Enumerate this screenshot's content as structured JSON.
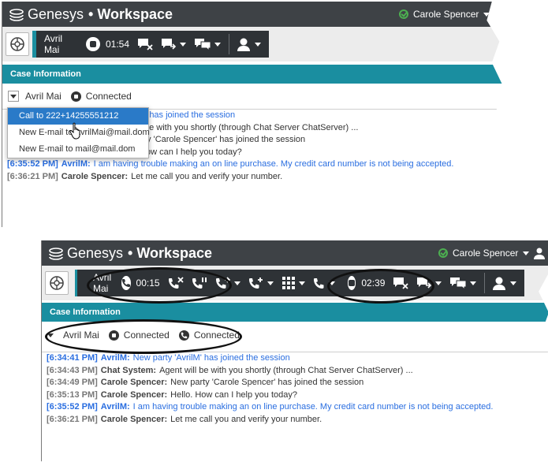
{
  "app": {
    "brand": "Genesys",
    "title": "Workspace"
  },
  "user": {
    "name": "Carole Spencer",
    "status_color": "#4caf50"
  },
  "colors": {
    "header": "#3e4246",
    "accent": "#1a8ea0",
    "customer_text": "#2a6ee0",
    "selected": "#2a7ac8"
  },
  "panel1": {
    "call": {
      "party": "Avril Mai",
      "timer": "01:54",
      "media_icon": "chat-bubble-icon"
    },
    "case_info_label": "Case Information",
    "case_row": {
      "party": "Avril Mai",
      "status": "Connected"
    },
    "dropdown": [
      {
        "label": "Call to 222+14255551212",
        "selected": true
      },
      {
        "label": "New E-mail to AvrilMai@mail.dom",
        "selected": false
      },
      {
        "label": "New E-mail to mail@mail.dom",
        "selected": false
      }
    ],
    "transcript": [
      {
        "visible": "M' has joined the session",
        "kind": "customer"
      },
      {
        "visible": "be with you shortly (through Chat Server ChatServer) ...",
        "kind": "system"
      },
      {
        "visible": "ty 'Carole Spencer' has joined the session",
        "kind": "agent"
      },
      {
        "visible": "ow can I help you today?",
        "kind": "agent"
      },
      {
        "ts": "[6:35:52 PM]",
        "who": "AvrilM:",
        "msg": "I am having trouble making an on line purchase. My credit card number is not being accepted.",
        "kind": "customer"
      },
      {
        "ts": "[6:36:21 PM]",
        "who": "Carole Spencer:",
        "msg": "Let me call you and verify your number.",
        "kind": "agent"
      }
    ]
  },
  "panel2": {
    "voice_call": {
      "party": "Avril Mai",
      "timer": "00:15"
    },
    "chat_call": {
      "timer": "02:39"
    },
    "case_info_label": "Case Information",
    "case_row": {
      "party": "Avril Mai",
      "status_chat": "Connected",
      "status_voice": "Connected"
    },
    "transcript": [
      {
        "ts": "[6:34:41 PM]",
        "who": "AvrilM:",
        "msg": "New party 'AvrilM' has joined the session",
        "kind": "customer"
      },
      {
        "ts": "[6:34:43 PM]",
        "who": "Chat System:",
        "msg": "Agent will be with you shortly (through Chat Server ChatServer) ...",
        "kind": "system"
      },
      {
        "ts": "[6:34:49 PM]",
        "who": "Carole Spencer:",
        "msg": "New party 'Carole Spencer' has joined the session",
        "kind": "agent"
      },
      {
        "ts": "[6:35:13 PM]",
        "who": "Carole Spencer:",
        "msg": "Hello. How can I help you today?",
        "kind": "agent"
      },
      {
        "ts": "[6:35:52 PM]",
        "who": "AvrilM:",
        "msg": "I am having trouble making an on line purchase. My credit card number is not being accepted.",
        "kind": "customer"
      },
      {
        "ts": "[6:36:21 PM]",
        "who": "Carole Spencer:",
        "msg": "Let me call you and verify your number.",
        "kind": "agent"
      }
    ]
  }
}
